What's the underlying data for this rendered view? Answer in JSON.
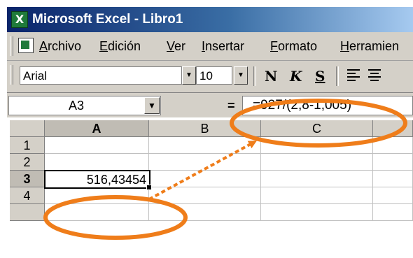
{
  "window": {
    "title": "Microsoft Excel - Libro1"
  },
  "menu": [
    {
      "accel": "A",
      "rest": "rchivo"
    },
    {
      "accel": "E",
      "rest": "dición"
    },
    {
      "accel": "V",
      "rest": "er"
    },
    {
      "accel": "I",
      "rest": "nsertar"
    },
    {
      "accel": "F",
      "rest": "ormato"
    },
    {
      "accel": "H",
      "rest": "erramien"
    }
  ],
  "toolbar": {
    "font": "Arial",
    "size": "10",
    "bold": "N",
    "italic": "K",
    "underline": "S"
  },
  "formula_bar": {
    "name_box": "A3",
    "equals": "=",
    "formula": "=927/(2,8-1,005)"
  },
  "columns": [
    "A",
    "B",
    "C"
  ],
  "rows": [
    "1",
    "2",
    "3",
    "4"
  ],
  "cells": {
    "A3": "516,43454"
  },
  "annotation": {
    "accent_color": "#ef7d1a"
  }
}
